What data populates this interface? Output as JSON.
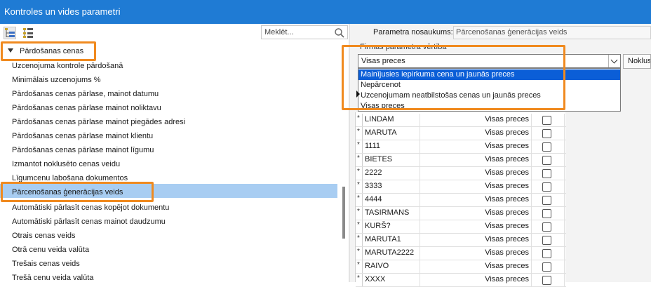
{
  "window": {
    "title": "Kontroles un vides parametri"
  },
  "toolbar": {
    "expand_icon": "tree-expand-icon",
    "collapse_icon": "tree-collapse-icon"
  },
  "search": {
    "placeholder": "Meklēt...",
    "icon": "search-icon"
  },
  "tree": {
    "group_label": "Pārdošanas cenas",
    "items": [
      "Uzcenojuma kontrole pārdošanā",
      "Minimālais uzcenojums %",
      "Pārdošanas cenas pārlase, mainot datumu",
      "Pārdošanas cenas pārlase mainot noliktavu",
      "Pārdošanas cenas pārlase mainot piegādes adresi",
      "Pārdošanas cenas pārlase mainot klientu",
      "Pārdošanas cenas pārlase mainot līgumu",
      "Izmantot noklusēto cenas veidu",
      "Līgumcenu labošana dokumentos",
      "Pārcenošanas ģenerācijas veids",
      "Automātiski pārlasīt cenas kopējot dokumentu",
      "Automātiski pārlasīt cenas mainot daudzumu",
      "Otrais cenas veids",
      "Otrā cenu veida valūta",
      "Trešais cenas veids",
      "Trešā cenu veida valūta"
    ],
    "selected_index": 9
  },
  "details": {
    "param_name_label": "Parametra nosaukums:",
    "param_name_value": "Pārcenošanas ģenerācijas veids",
    "value_section_label": "Firmas parametra vērtība",
    "combo_value": "Visas preces",
    "side_button_label": "Noklus",
    "dropdown_options": [
      "Mainījusies iepirkuma cena un jaunās preces",
      "Nepārcenot",
      "Uzcenojumam neatbilstošas cenas un jaunās preces",
      "Visas preces"
    ],
    "dropdown_highlighted": 0
  },
  "grid": {
    "row_marker": "*",
    "rows": [
      {
        "name": "LINDAM",
        "value": "Visas preces"
      },
      {
        "name": "MARUTA",
        "value": "Visas preces"
      },
      {
        "name": "1111",
        "value": "Visas preces"
      },
      {
        "name": "BIETES",
        "value": "Visas preces"
      },
      {
        "name": "2222",
        "value": "Visas preces"
      },
      {
        "name": "3333",
        "value": "Visas preces"
      },
      {
        "name": "4444",
        "value": "Visas preces"
      },
      {
        "name": "TASIRMANS",
        "value": "Visas preces"
      },
      {
        "name": "KURŠ?",
        "value": "Visas preces"
      },
      {
        "name": "MARUTA1",
        "value": "Visas preces"
      },
      {
        "name": "MARUTA2222",
        "value": "Visas preces"
      },
      {
        "name": "RAIVO",
        "value": "Visas preces"
      },
      {
        "name": "XXXX",
        "value": "Visas preces"
      }
    ]
  },
  "colors": {
    "titlebar": "#1f7bd4",
    "selection": "#a8cdf2",
    "dropdown_highlight": "#0b5ed7",
    "annotation": "#f08a1f"
  }
}
